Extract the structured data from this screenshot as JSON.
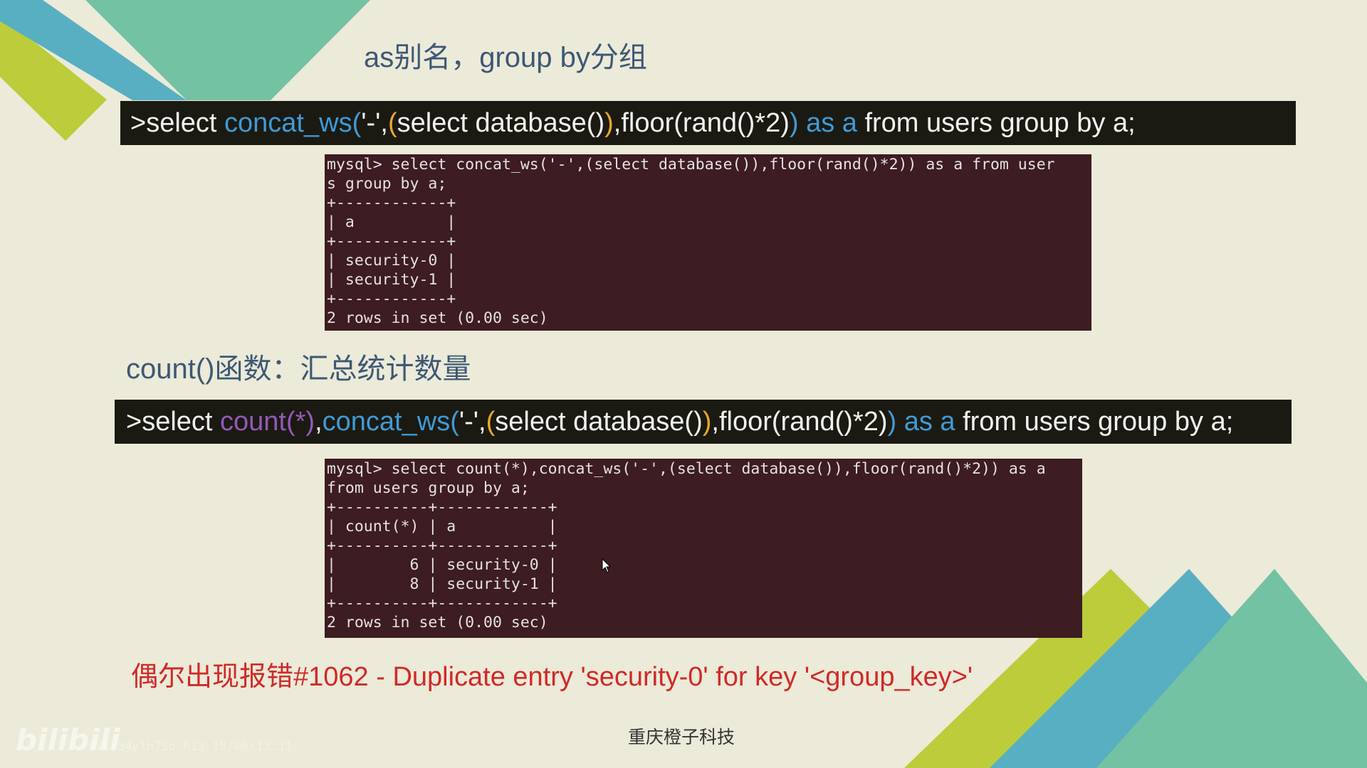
{
  "slide": {
    "title": "as别名，group by分组",
    "cmd1": {
      "prompt": ">select ",
      "fn": "concat_ws(",
      "sep": "'-',",
      "open_paren": "(",
      "subquery": "select database()",
      "close_paren": ")",
      "floor": ",floor(rand()*2)",
      "close2": ")",
      "as_kw": " as a",
      "rest": " from users group by a;"
    },
    "term1": {
      "lines": [
        "mysql> select concat_ws('-',(select database()),floor(rand()*2)) as a from user",
        "s group by a;",
        "+------------+",
        "| a          |",
        "+------------+",
        "| security-0 |",
        "| security-1 |",
        "+------------+",
        "2 rows in set (0.00 sec)"
      ]
    },
    "subtitle": "count()函数：汇总统计数量",
    "cmd2": {
      "prompt": ">select ",
      "count": "count(*)",
      "comma": ",",
      "fn": "concat_ws(",
      "sep": "'-',",
      "open_paren": "(",
      "subquery": "select database()",
      "close_paren": ")",
      "floor": ",floor(rand()*2)",
      "close2": ")",
      "as_kw": " as a",
      "rest": " from users group by a;"
    },
    "term2": {
      "lines": [
        "mysql> select count(*),concat_ws('-',(select database()),floor(rand()*2)) as a",
        "from users group by a;",
        "+----------+------------+",
        "| count(*) | a          |",
        "+----------+------------+",
        "|        6 | security-0 |",
        "|        8 | security-1 |",
        "+----------+------------+",
        "2 rows in set (0.00 sec)"
      ]
    },
    "error_text": "偶尔出现报错#1062 - Duplicate entry 'security-0' for key '<group_key>'",
    "footer": "重庆橙子科技",
    "watermark": "bilibili",
    "watermark_code": "BV1r34y1h7So P13 18/06/13:11"
  },
  "colors": {
    "background": "#ecead8",
    "heading": "#3d5875",
    "command_bar": "#1b1a12",
    "terminal": "#3d1c22",
    "function_blue": "#3f9ad6",
    "paren_orange": "#e7a92a",
    "count_purple": "#9359b8",
    "error_red": "#cf2a28",
    "deco_lime": "#bccc3a",
    "deco_blue": "#58afc2",
    "deco_teal": "#73c2a4"
  }
}
